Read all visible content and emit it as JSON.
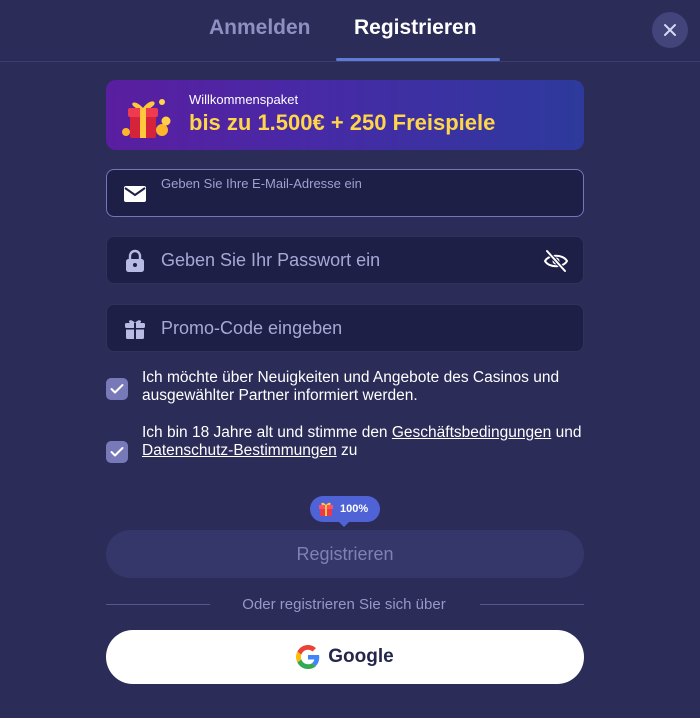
{
  "tabs": {
    "login": "Anmelden",
    "register": "Registrieren"
  },
  "banner": {
    "title": "Willkommenspaket",
    "offer": "bis zu 1.500€ + 250 Freispiele"
  },
  "form": {
    "email": {
      "label": "Geben Sie Ihre E-Mail-Adresse ein",
      "value": "",
      "placeholder": ""
    },
    "password": {
      "placeholder": "Geben Sie Ihr Passwort ein"
    },
    "promo": {
      "placeholder": "Promo-Code eingeben"
    }
  },
  "consents": {
    "news": {
      "checked": true,
      "text": "Ich möchte über Neuigkeiten und Angebote des Casinos und ausgewählter Partner informiert werden."
    },
    "terms": {
      "checked": true,
      "prefix": "Ich bin 18 Jahre alt und stimme den ",
      "link1": "Geschäftsbedingungen",
      "middle": " und ",
      "link2": "Datenschutz-Bestimmungen",
      "suffix": " zu"
    }
  },
  "bonus_badge": {
    "text": "100%"
  },
  "register_button": "Registrieren",
  "divider_text": "Oder registrieren Sie sich über",
  "google_button": "Google",
  "colors": {
    "background": "#2b2c58",
    "field_background": "#1e1f47",
    "accent": "#5d7bd7",
    "offer_yellow": "#ffd64a",
    "badge_blue": "#4f63d6"
  },
  "icons": [
    "close-icon",
    "gift-box-icon",
    "envelope-icon",
    "lock-icon",
    "eye-off-icon",
    "gift-icon",
    "checkmark-icon",
    "google-icon"
  ]
}
